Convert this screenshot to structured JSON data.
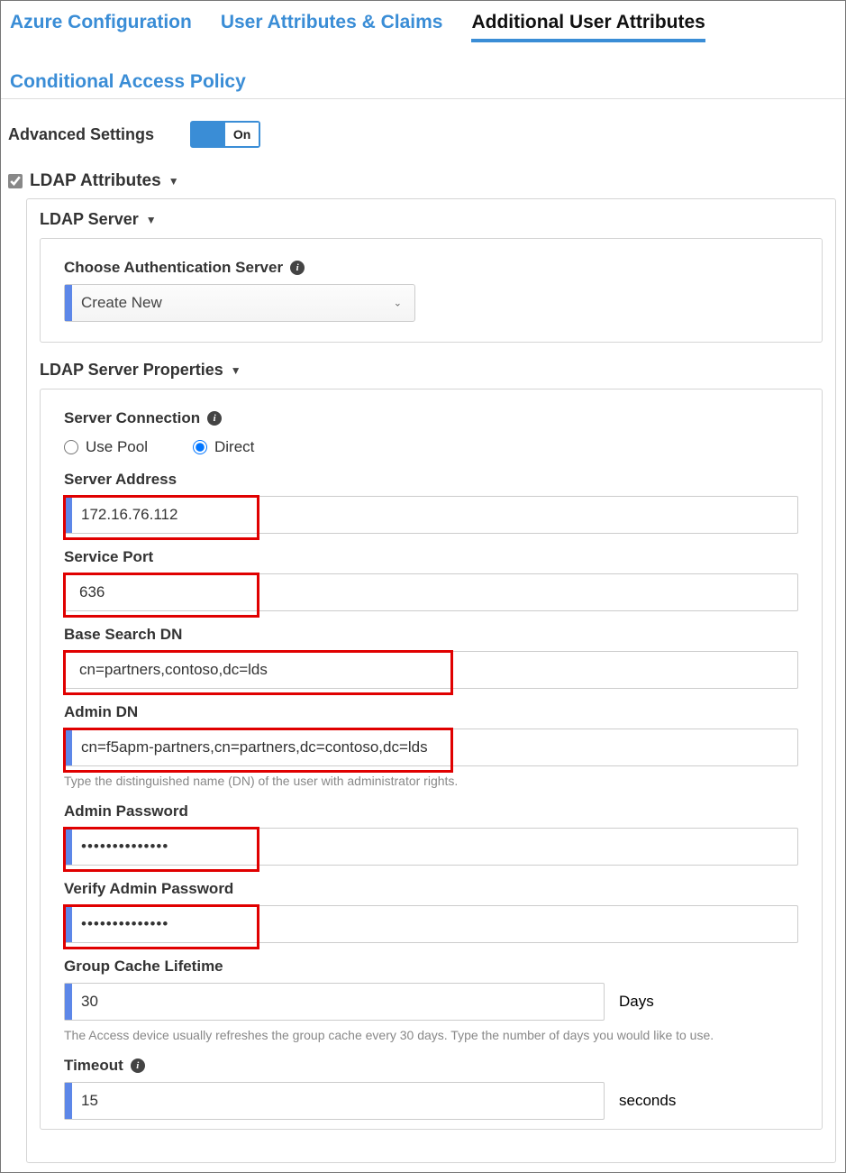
{
  "tabs": {
    "azure": "Azure Configuration",
    "claims": "User Attributes & Claims",
    "additional": "Additional User Attributes",
    "policy": "Conditional Access Policy"
  },
  "advanced": {
    "label": "Advanced Settings",
    "toggle": "On"
  },
  "ldap": {
    "section_label": "LDAP Attributes",
    "server_title": "LDAP Server",
    "choose_label": "Choose Authentication Server",
    "choose_value": "Create New",
    "props_title": "LDAP Server Properties",
    "conn_label": "Server Connection",
    "conn_pool": "Use Pool",
    "conn_direct": "Direct",
    "addr_label": "Server Address",
    "addr_value": "172.16.76.112",
    "port_label": "Service Port",
    "port_value": "636",
    "base_dn_label": "Base Search DN",
    "base_dn_value": "cn=partners,contoso,dc=lds",
    "admin_dn_label": "Admin DN",
    "admin_dn_value": "cn=f5apm-partners,cn=partners,dc=contoso,dc=lds",
    "admin_dn_hint": "Type the distinguished name (DN) of the user with administrator rights.",
    "pwd_label": "Admin Password",
    "pwd_value": "••••••••••••••",
    "vpwd_label": "Verify Admin Password",
    "vpwd_value": "••••••••••••••",
    "cache_label": "Group Cache Lifetime",
    "cache_value": "30",
    "cache_unit": "Days",
    "cache_hint": "The Access device usually refreshes the group cache every 30 days. Type the number of days you would like to use.",
    "timeout_label": "Timeout",
    "timeout_value": "15",
    "timeout_unit": "seconds"
  }
}
